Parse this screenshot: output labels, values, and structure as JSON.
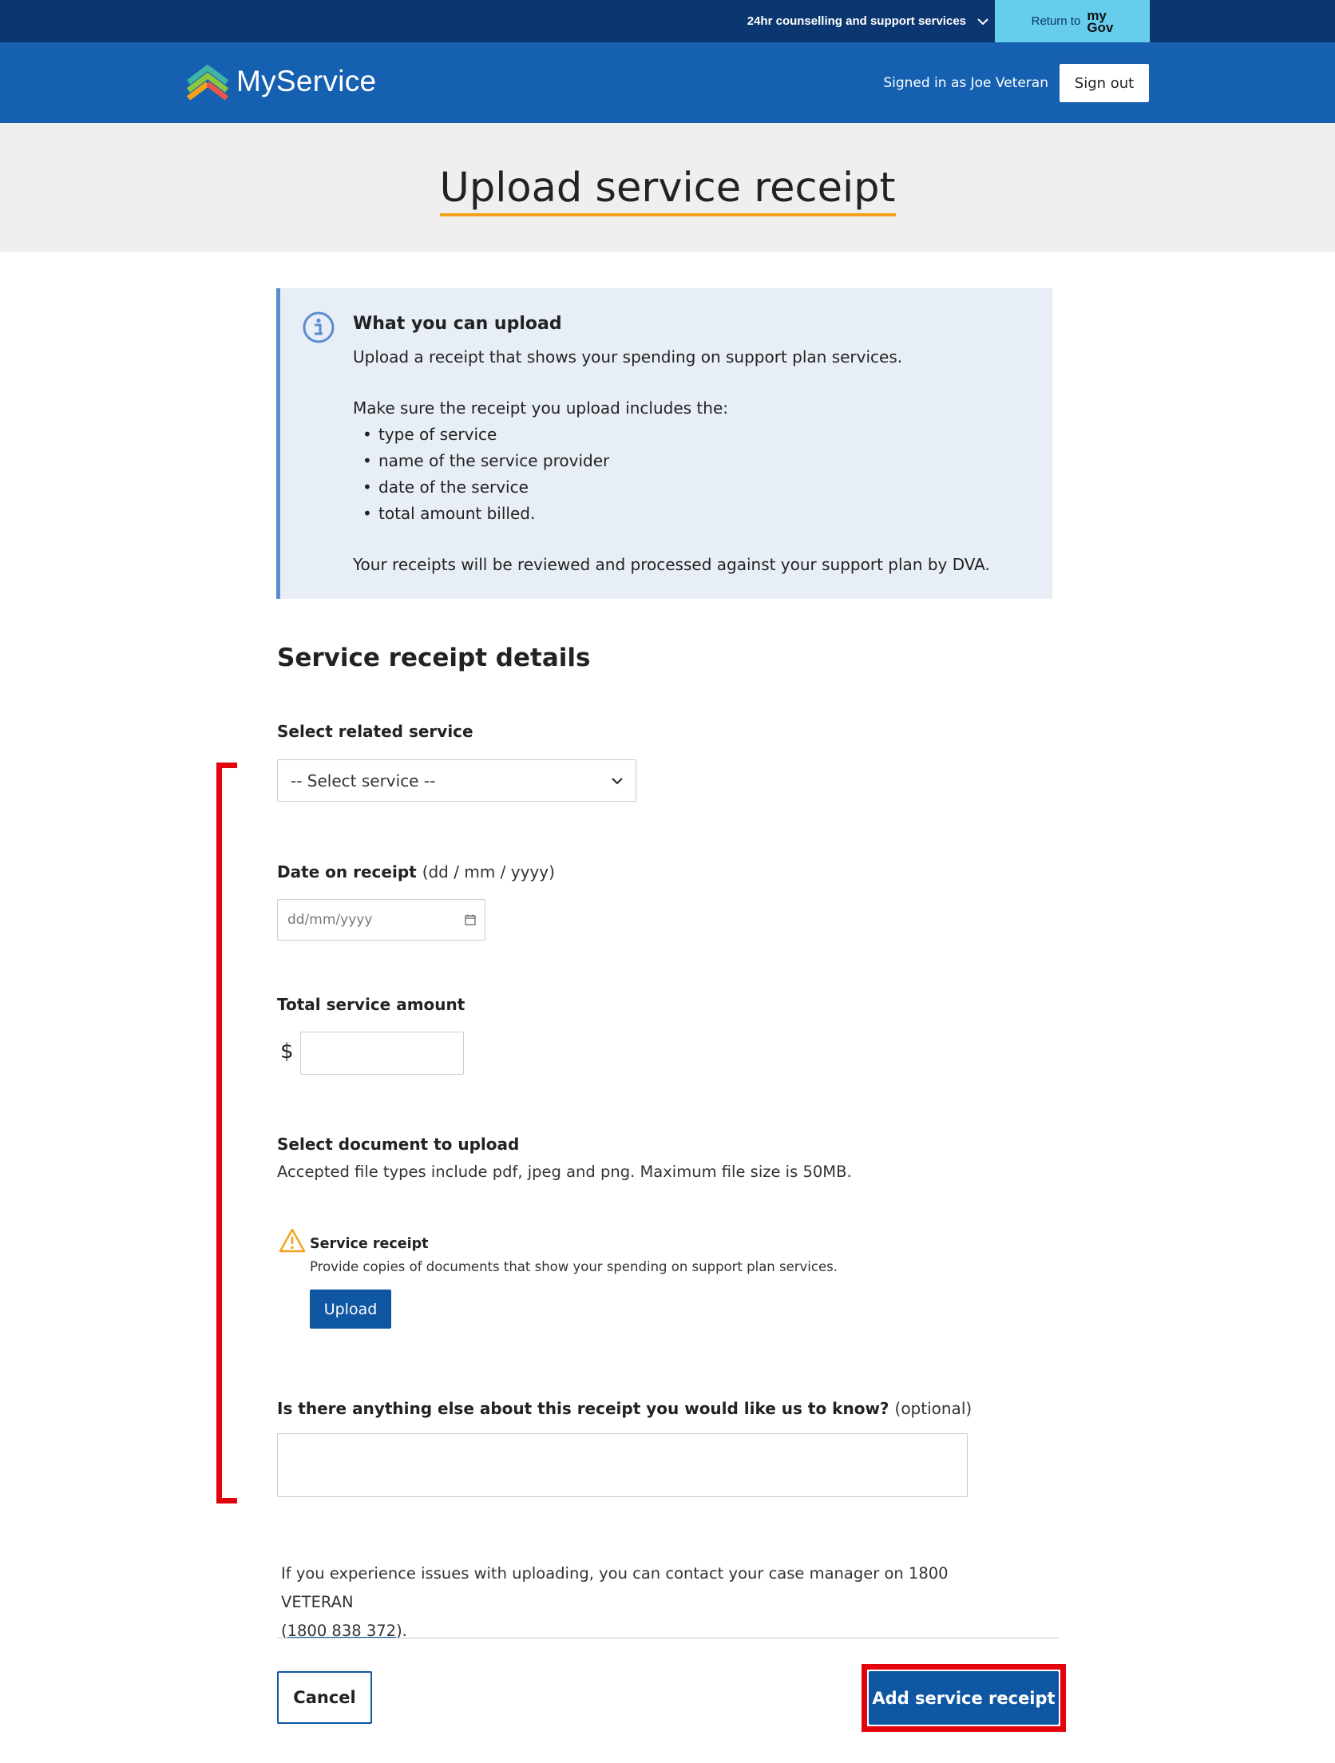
{
  "utility_bar": {
    "support_label": "24hr counselling and support services",
    "return_label": "Return to",
    "mygov_top": "my",
    "mygov_bottom": "Gov"
  },
  "header": {
    "brand": "MyService",
    "signed_in": "Signed in as Joe Veteran",
    "sign_out": "Sign out"
  },
  "page": {
    "title": "Upload service receipt"
  },
  "callout": {
    "title": "What you can upload",
    "intro": "Upload a receipt that shows your spending on support plan services.",
    "list_intro": "Make sure the receipt you upload includes the:",
    "items": [
      "type of service",
      "name of the service provider",
      "date of the service",
      "total amount billed."
    ],
    "footer": "Your receipts will be reviewed and processed against your support plan by DVA."
  },
  "form": {
    "section_title": "Service receipt details",
    "service_label": "Select related service",
    "service_selected": "-- Select service --",
    "date_label": "Date on receipt",
    "date_hint": "(dd / mm / yyyy)",
    "date_placeholder": "dd/mm/yyyy",
    "amount_label": "Total service amount",
    "currency_symbol": "$",
    "amount_value": "",
    "document_label": "Select document to upload",
    "document_help": "Accepted file types include pdf, jpeg and png. Maximum file size is 50MB.",
    "doc_title": "Service receipt",
    "doc_help": "Provide copies of documents that show your spending on support plan services.",
    "upload_label": "Upload",
    "notes_label": "Is there anything else about this receipt you would like us to know?",
    "notes_optional": "(optional)",
    "notes_value": ""
  },
  "contact": {
    "text": "If you experience issues with uploading, you can contact your case manager on 1800 VETERAN",
    "paren_open": "(",
    "phone": "1800 838 372",
    "paren_close": ")."
  },
  "actions": {
    "cancel": "Cancel",
    "submit": "Add service receipt"
  },
  "colors": {
    "utility_bar": "#0b3670",
    "header": "#1560b0",
    "primary_button": "#0f56a3",
    "accent_underline": "#f5a11c",
    "highlight_red": "#e2030f",
    "return_button": "#66cdec"
  }
}
